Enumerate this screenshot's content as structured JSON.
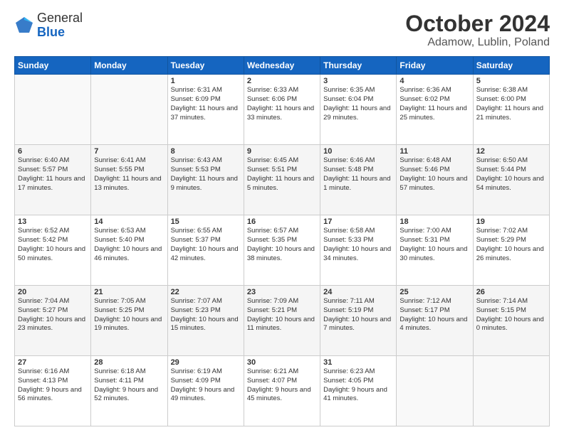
{
  "header": {
    "logo_general": "General",
    "logo_blue": "Blue",
    "month": "October 2024",
    "location": "Adamow, Lublin, Poland"
  },
  "days_of_week": [
    "Sunday",
    "Monday",
    "Tuesday",
    "Wednesday",
    "Thursday",
    "Friday",
    "Saturday"
  ],
  "weeks": [
    [
      {
        "day": "",
        "info": ""
      },
      {
        "day": "",
        "info": ""
      },
      {
        "day": "1",
        "info": "Sunrise: 6:31 AM\nSunset: 6:09 PM\nDaylight: 11 hours and 37 minutes."
      },
      {
        "day": "2",
        "info": "Sunrise: 6:33 AM\nSunset: 6:06 PM\nDaylight: 11 hours and 33 minutes."
      },
      {
        "day": "3",
        "info": "Sunrise: 6:35 AM\nSunset: 6:04 PM\nDaylight: 11 hours and 29 minutes."
      },
      {
        "day": "4",
        "info": "Sunrise: 6:36 AM\nSunset: 6:02 PM\nDaylight: 11 hours and 25 minutes."
      },
      {
        "day": "5",
        "info": "Sunrise: 6:38 AM\nSunset: 6:00 PM\nDaylight: 11 hours and 21 minutes."
      }
    ],
    [
      {
        "day": "6",
        "info": "Sunrise: 6:40 AM\nSunset: 5:57 PM\nDaylight: 11 hours and 17 minutes."
      },
      {
        "day": "7",
        "info": "Sunrise: 6:41 AM\nSunset: 5:55 PM\nDaylight: 11 hours and 13 minutes."
      },
      {
        "day": "8",
        "info": "Sunrise: 6:43 AM\nSunset: 5:53 PM\nDaylight: 11 hours and 9 minutes."
      },
      {
        "day": "9",
        "info": "Sunrise: 6:45 AM\nSunset: 5:51 PM\nDaylight: 11 hours and 5 minutes."
      },
      {
        "day": "10",
        "info": "Sunrise: 6:46 AM\nSunset: 5:48 PM\nDaylight: 11 hours and 1 minute."
      },
      {
        "day": "11",
        "info": "Sunrise: 6:48 AM\nSunset: 5:46 PM\nDaylight: 10 hours and 57 minutes."
      },
      {
        "day": "12",
        "info": "Sunrise: 6:50 AM\nSunset: 5:44 PM\nDaylight: 10 hours and 54 minutes."
      }
    ],
    [
      {
        "day": "13",
        "info": "Sunrise: 6:52 AM\nSunset: 5:42 PM\nDaylight: 10 hours and 50 minutes."
      },
      {
        "day": "14",
        "info": "Sunrise: 6:53 AM\nSunset: 5:40 PM\nDaylight: 10 hours and 46 minutes."
      },
      {
        "day": "15",
        "info": "Sunrise: 6:55 AM\nSunset: 5:37 PM\nDaylight: 10 hours and 42 minutes."
      },
      {
        "day": "16",
        "info": "Sunrise: 6:57 AM\nSunset: 5:35 PM\nDaylight: 10 hours and 38 minutes."
      },
      {
        "day": "17",
        "info": "Sunrise: 6:58 AM\nSunset: 5:33 PM\nDaylight: 10 hours and 34 minutes."
      },
      {
        "day": "18",
        "info": "Sunrise: 7:00 AM\nSunset: 5:31 PM\nDaylight: 10 hours and 30 minutes."
      },
      {
        "day": "19",
        "info": "Sunrise: 7:02 AM\nSunset: 5:29 PM\nDaylight: 10 hours and 26 minutes."
      }
    ],
    [
      {
        "day": "20",
        "info": "Sunrise: 7:04 AM\nSunset: 5:27 PM\nDaylight: 10 hours and 23 minutes."
      },
      {
        "day": "21",
        "info": "Sunrise: 7:05 AM\nSunset: 5:25 PM\nDaylight: 10 hours and 19 minutes."
      },
      {
        "day": "22",
        "info": "Sunrise: 7:07 AM\nSunset: 5:23 PM\nDaylight: 10 hours and 15 minutes."
      },
      {
        "day": "23",
        "info": "Sunrise: 7:09 AM\nSunset: 5:21 PM\nDaylight: 10 hours and 11 minutes."
      },
      {
        "day": "24",
        "info": "Sunrise: 7:11 AM\nSunset: 5:19 PM\nDaylight: 10 hours and 7 minutes."
      },
      {
        "day": "25",
        "info": "Sunrise: 7:12 AM\nSunset: 5:17 PM\nDaylight: 10 hours and 4 minutes."
      },
      {
        "day": "26",
        "info": "Sunrise: 7:14 AM\nSunset: 5:15 PM\nDaylight: 10 hours and 0 minutes."
      }
    ],
    [
      {
        "day": "27",
        "info": "Sunrise: 6:16 AM\nSunset: 4:13 PM\nDaylight: 9 hours and 56 minutes."
      },
      {
        "day": "28",
        "info": "Sunrise: 6:18 AM\nSunset: 4:11 PM\nDaylight: 9 hours and 52 minutes."
      },
      {
        "day": "29",
        "info": "Sunrise: 6:19 AM\nSunset: 4:09 PM\nDaylight: 9 hours and 49 minutes."
      },
      {
        "day": "30",
        "info": "Sunrise: 6:21 AM\nSunset: 4:07 PM\nDaylight: 9 hours and 45 minutes."
      },
      {
        "day": "31",
        "info": "Sunrise: 6:23 AM\nSunset: 4:05 PM\nDaylight: 9 hours and 41 minutes."
      },
      {
        "day": "",
        "info": ""
      },
      {
        "day": "",
        "info": ""
      }
    ]
  ]
}
